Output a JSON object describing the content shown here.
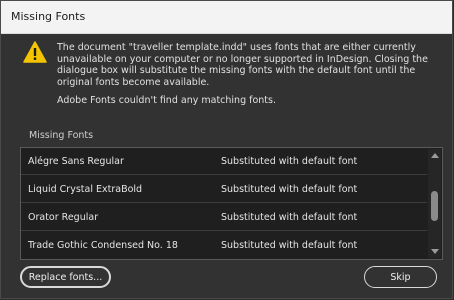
{
  "window": {
    "title": "Missing Fonts"
  },
  "message": {
    "line1": "The document \"traveller template.indd\" uses fonts that are either currently unavailable on your computer or no longer supported in InDesign. Closing the dialogue box will substitute the missing fonts with the default font until the original fonts become available.",
    "line2": "Adobe Fonts couldn't find any matching fonts."
  },
  "list": {
    "label": "Missing Fonts",
    "rows": [
      {
        "name": "Alégre Sans Regular",
        "status": "Substituted with default font"
      },
      {
        "name": "Liquid Crystal ExtraBold",
        "status": "Substituted with default font"
      },
      {
        "name": "Orator Regular",
        "status": "Substituted with default font"
      },
      {
        "name": "Trade Gothic Condensed No. 18",
        "status": "Substituted with default font"
      }
    ]
  },
  "buttons": {
    "replace": "Replace fonts...",
    "skip": "Skip"
  },
  "colors": {
    "warning": "#f5c400",
    "dialog_bg": "#323232",
    "list_bg": "#1f1f1f"
  },
  "icons": {
    "warning": "warning-triangle-icon"
  }
}
